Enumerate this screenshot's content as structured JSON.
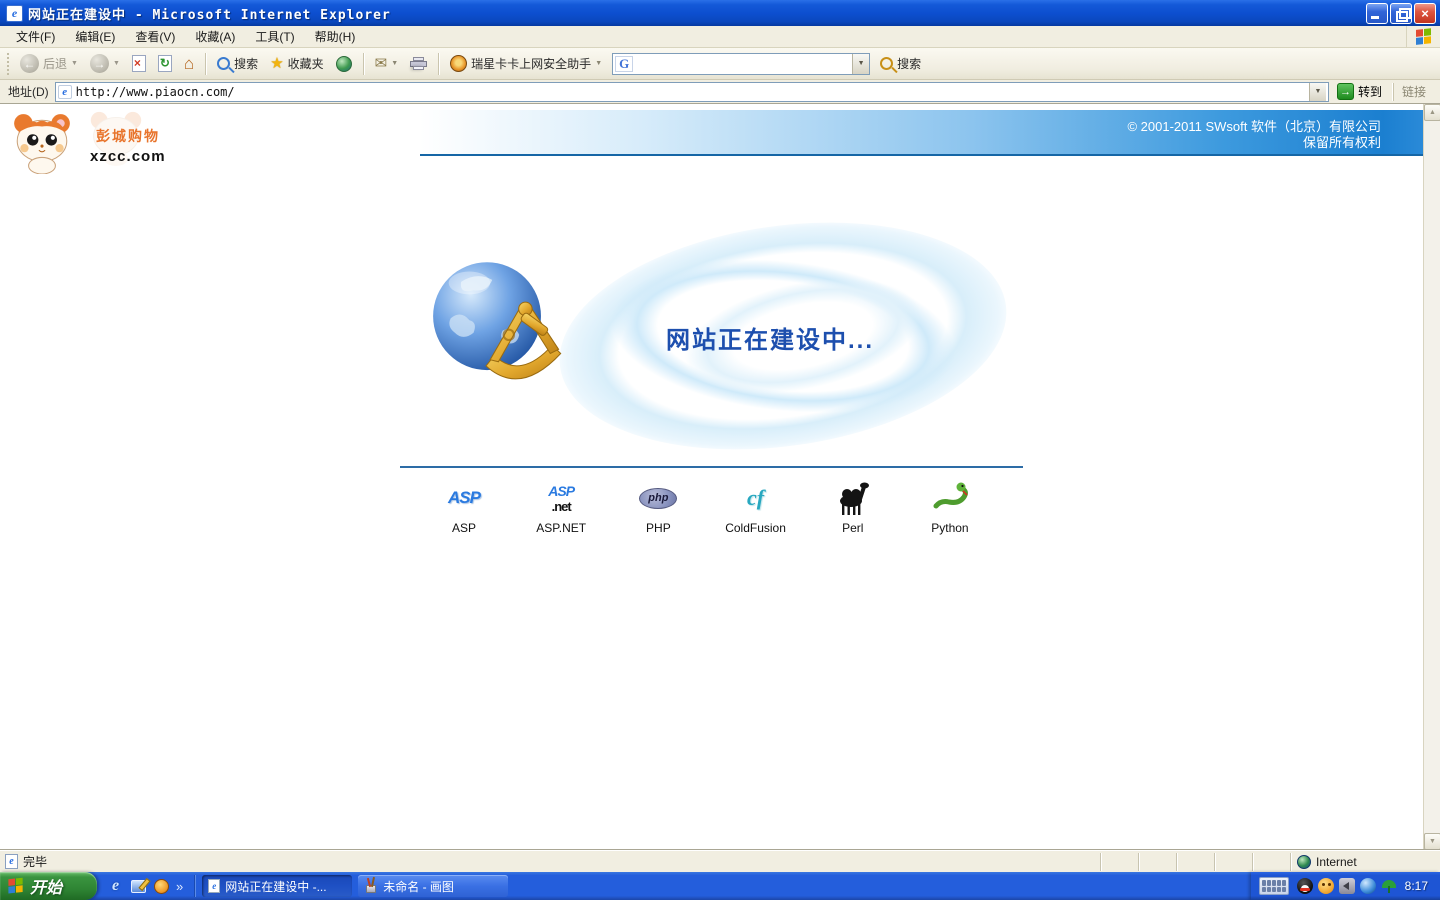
{
  "window": {
    "title": "网站正在建设中 - Microsoft Internet Explorer"
  },
  "menu": {
    "items": [
      "文件(F)",
      "编辑(E)",
      "查看(V)",
      "收藏(A)",
      "工具(T)",
      "帮助(H)"
    ]
  },
  "toolbar": {
    "back_label": "后退",
    "search_label": "搜索",
    "favorites_label": "收藏夹",
    "rising_label": "瑞星卡卡上网安全助手",
    "google_search_value": "",
    "toolbar_search_label": "搜索"
  },
  "addressbar": {
    "label": "地址(D)",
    "url": "http://www.piaocn.com/",
    "go_label": "转到",
    "links_label": "链接"
  },
  "page": {
    "logo": {
      "site_name": "彭城购物",
      "domain": "xzcc.com"
    },
    "banner": {
      "copyright_line1": "© 2001-2011 SWsoft 软件（北京）有限公司",
      "copyright_line2": "保留所有权利"
    },
    "headline": "网站正在建设中...",
    "technologies": [
      {
        "label": "ASP",
        "icon_text": "ASP"
      },
      {
        "label": "ASP.NET",
        "icon_top": "ASP",
        "icon_bottom": ".net"
      },
      {
        "label": "PHP",
        "icon_text": "php"
      },
      {
        "label": "ColdFusion",
        "icon_text": "cf"
      },
      {
        "label": "Perl"
      },
      {
        "label": "Python"
      }
    ]
  },
  "statusbar": {
    "status": "完毕",
    "zone": "Internet"
  },
  "taskbar": {
    "start_label": "开始",
    "tasks": [
      {
        "label": "网站正在建设中 -...",
        "active": true
      },
      {
        "label": "未命名 - 画图",
        "active": false
      }
    ],
    "clock": "8:17"
  },
  "icons": {
    "ie_letter": "e",
    "back_arrow": "←",
    "forward_arrow": "→",
    "stop_x": "×",
    "refresh_arrow": "↻",
    "home_glyph": "⌂",
    "star": "★",
    "mail_glyph": "✉",
    "dropdown": "▼",
    "chevron": "»",
    "google_g": "G",
    "go_arrow": "→",
    "scroll_up": "▲",
    "scroll_down": "▼",
    "close_x": "×"
  },
  "colors": {
    "banner_blue": "#1b7fd0",
    "headline_blue": "#1d4fae",
    "taskbar_blue": "#245edc",
    "start_green": "#3a9440",
    "xp_beige": "#f1eee1"
  }
}
